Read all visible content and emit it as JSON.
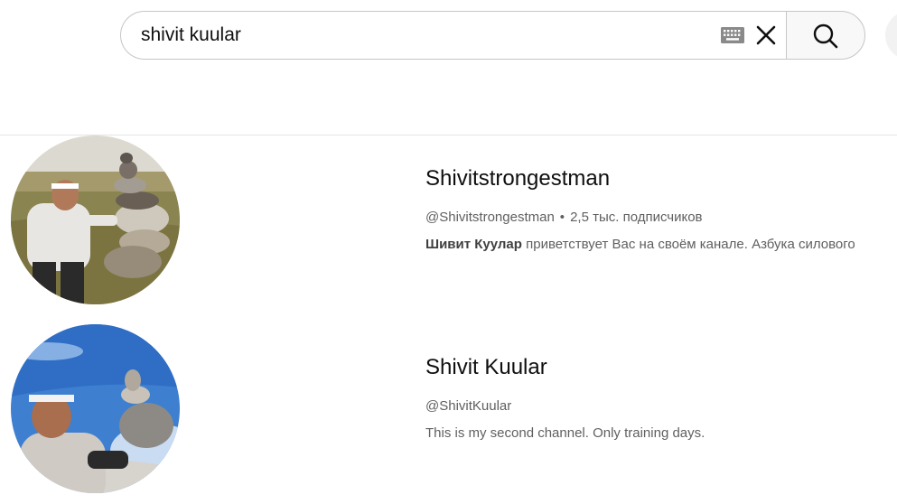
{
  "search": {
    "value": "shivit kuular"
  },
  "results": [
    {
      "name": "Shivitstrongestman",
      "handle": "@Shivitstrongestman",
      "subscribers": "2,5 тыс. подписчиков",
      "desc_bold": "Шивит Куулар",
      "desc_rest": " приветствует Вас на своём канале. Азбука силового"
    },
    {
      "name": "Shivit Kuular",
      "handle": "@ShivitKuular",
      "description": "This is my second channel. Only training days."
    }
  ],
  "icons": {
    "keyboard": "keyboard-icon",
    "clear": "close-icon",
    "search": "search-icon"
  }
}
